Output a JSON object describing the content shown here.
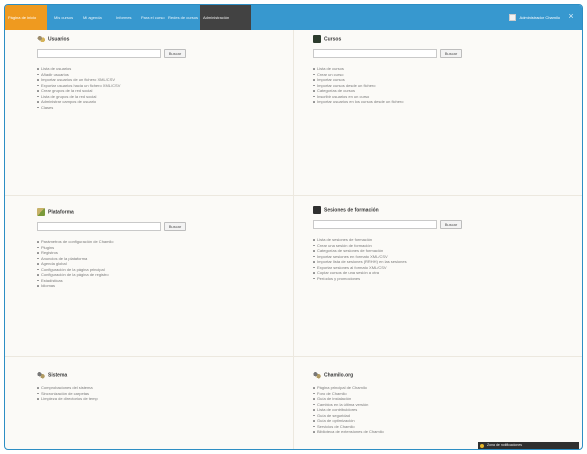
{
  "topbar": {
    "home_tab": "Página de inicio",
    "tabs": [
      "Mis cursos",
      "Mi agenda",
      "Informes",
      "Para el curso",
      "Redes de cursos"
    ],
    "admin_tab": "Administración",
    "user_name": "Administrador Chamilo",
    "close_glyph": "×"
  },
  "panels": [
    {
      "title": "Usuarios",
      "icon": "users-icon",
      "search_button": "Buscar",
      "links": [
        "Lista de usuarios",
        "Añadir usuarios",
        "Importar usuarios de un fichero XML/CSV",
        "Exportar usuarios hacia un fichero XML/CSV",
        "Crear grupos de la red social",
        "Lista de grupos de la red social",
        "Administrar campos de usuario",
        "Clases"
      ]
    },
    {
      "title": "Cursos",
      "icon": "book-icon",
      "search_button": "Buscar",
      "links": [
        "Lista de cursos",
        "Crear un curso",
        "Importar cursos",
        "Importar cursos desde un fichero",
        "Categorías de cursos",
        "Inscribir usuarios en un curso",
        "Importar usuarios en los cursos desde un fichero"
      ]
    },
    {
      "title": "Plataforma",
      "icon": "plugin-icon",
      "search_button": "Buscar",
      "links": [
        "Parámetros de configuración de Chamilo",
        "Plugins",
        "Registros",
        "Anuncios de la plataforma",
        "Agenda global",
        "Configuración de la página principal",
        "Configuración de la página de registro",
        "Estadísticas",
        "Idiomas"
      ]
    },
    {
      "title": "Sesiones de formación",
      "icon": "sessions-icon",
      "search_button": "Buscar",
      "links": [
        "Lista de sesiones de formación",
        "Crear una sesión de formación",
        "Categorías de sesiones de formación",
        "Importar sesiones en formato XML/CSV",
        "Importar lista de sesiones (RRHH) en las sesiones",
        "Exportar sesiones al formato XML/CSV",
        "Copiar cursos de una sesión a otra",
        "Períodos y promociones"
      ]
    },
    {
      "title": "Sistema",
      "icon": "tools-icon",
      "links": [
        "Comprobaciones del sistema",
        "Sincronización de carpetas",
        "Limpieza de directorios de temp"
      ]
    },
    {
      "title": "Chamilo.org",
      "icon": "tools-icon",
      "links": [
        "Página principal de Chamilo",
        "Foro de Chamilo",
        "Guía de instalación",
        "Cambios en la última versión",
        "Lista de contribuidores",
        "Guía de seguridad",
        "Guía de optimización",
        "Servicios de Chamilo",
        "Biblioteca de extensiones de Chamilo"
      ]
    }
  ],
  "tray": {
    "label": "Zona de notificaciones"
  }
}
